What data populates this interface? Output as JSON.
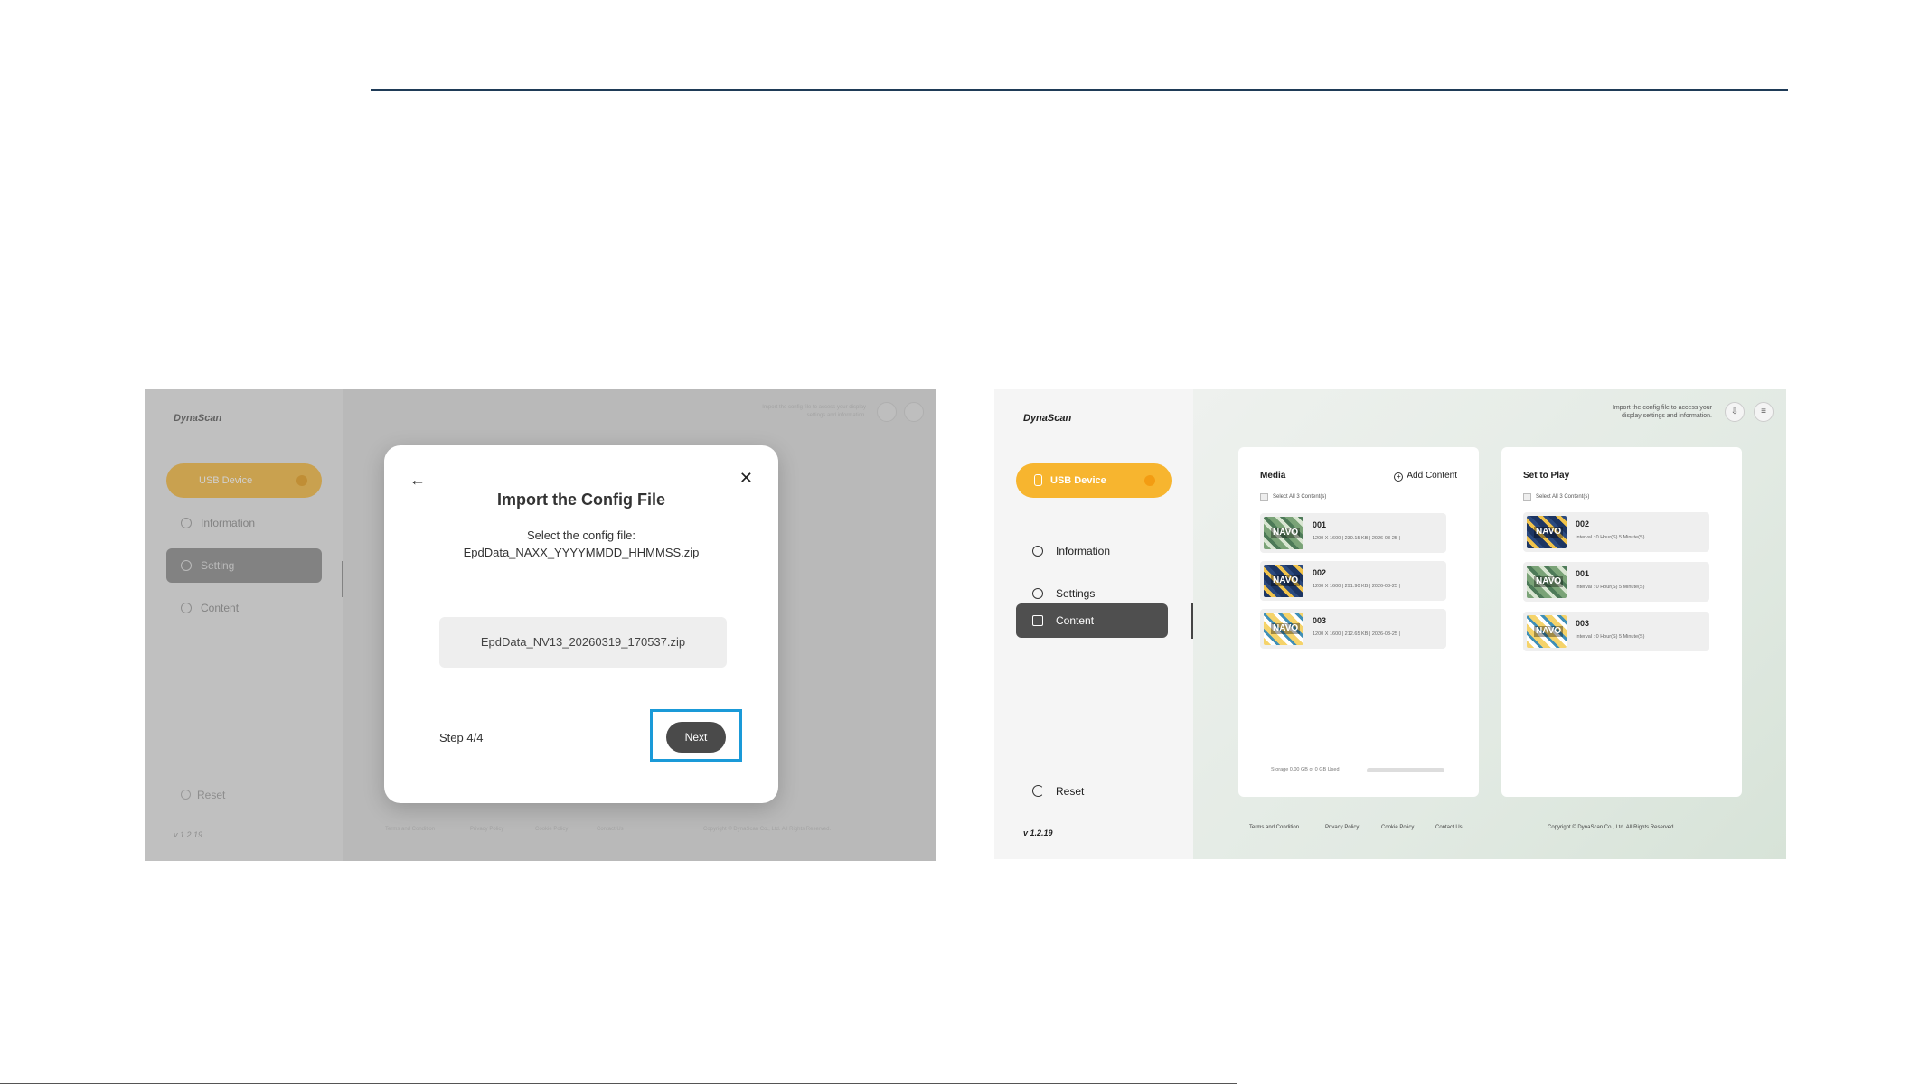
{
  "left_screen": {
    "logo": "DynaScan",
    "header_hint": "Import the config file to access your display settings and information.",
    "sidebar": {
      "usb_label": "USB Device",
      "items": [
        {
          "label": "Information"
        },
        {
          "label": "Setting"
        },
        {
          "label": "Content"
        }
      ],
      "reset_label": "Reset",
      "version": "v 1.2.19"
    },
    "footer": {
      "links": [
        "Terms and Condition",
        "Privacy Policy",
        "Cookie Policy",
        "Contact Us"
      ],
      "copyright": "Copyright © DynaScan Co., Ltd. All Rights Reserved."
    },
    "modal": {
      "title": "Import the Config File",
      "subtitle_line1": "Select the config file:",
      "subtitle_line2": "EpdData_NAXX_YYYYMMDD_HHMMSS.zip",
      "file_name": "EpdData_NV13_20260319_170537.zip",
      "step": "Step 4/4",
      "next_label": "Next",
      "back_icon": "arrow-left-icon",
      "close_icon": "close-icon"
    }
  },
  "right_screen": {
    "logo": "DynaScan",
    "header_hint_line1": "Import the config file to access your",
    "header_hint_line2": "display settings and information.",
    "sidebar": {
      "usb_label": "USB Device",
      "items": [
        {
          "label": "Information",
          "icon": "info-icon"
        },
        {
          "label": "Settings",
          "icon": "gear-icon"
        },
        {
          "label": "Content",
          "icon": "image-icon"
        }
      ],
      "reset_label": "Reset",
      "version": "v 1.2.19"
    },
    "media_panel": {
      "title": "Media",
      "add_label": "Add Content",
      "select_all": "Select All 3 Content(s)",
      "items": [
        {
          "name": "001",
          "meta": "1200 X 1600  |  230.15 KB  |  2026-03-25 |"
        },
        {
          "name": "002",
          "meta": "1200 X 1600  |  291.90 KB  |  2026-03-25 |"
        },
        {
          "name": "003",
          "meta": "1200 X 1600  |  212.65 KB  |  2026-03-25 |"
        }
      ],
      "storage": "Storage 0.00 GB of 0 GB Used"
    },
    "play_panel": {
      "title": "Set to Play",
      "select_all": "Select All 3 Content(s)",
      "items": [
        {
          "name": "002",
          "meta": "Interval : 0 Hour(S) 5 Minute(S)"
        },
        {
          "name": "001",
          "meta": "Interval : 0 Hour(S) 5 Minute(S)"
        },
        {
          "name": "003",
          "meta": "Interval : 0 Hour(S) 5 Minute(S)"
        }
      ]
    },
    "footer": {
      "links": [
        "Terms and Condition",
        "Privacy Policy",
        "Cookie Policy",
        "Contact Us"
      ],
      "copyright": "Copyright © DynaScan Co., Ltd. All Rights Reserved."
    },
    "thumb_brand": "NAVO"
  },
  "colors": {
    "accent_yellow": "#f7b52f",
    "active_nav": "#4f4f4f",
    "highlight_box": "#1a9ad8",
    "rule": "#1f3b57"
  }
}
